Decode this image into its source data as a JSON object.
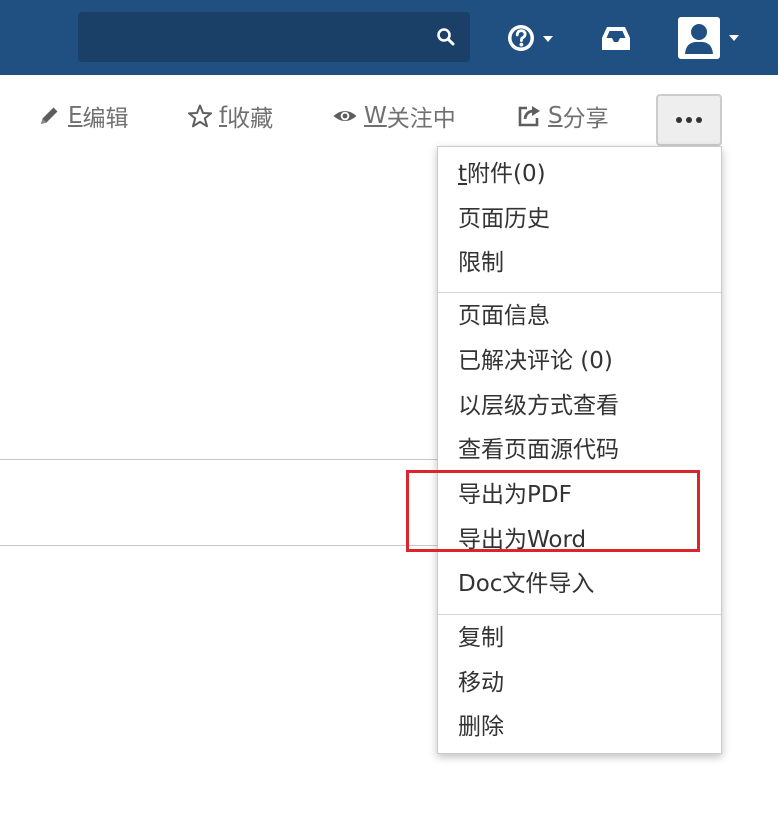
{
  "header": {
    "search": {
      "placeholder": "",
      "icon": "search-icon"
    },
    "help": {
      "icon": "help-icon"
    },
    "notifications": {
      "icon": "inbox-icon"
    },
    "user": {
      "icon": "user-avatar-icon"
    },
    "colors": {
      "bar": "#205081",
      "search_bg": "#1a4068"
    }
  },
  "toolbar": {
    "edit": {
      "key": "E",
      "label": "编辑",
      "icon": "pencil-icon"
    },
    "favorite": {
      "key": "f",
      "label": "收藏",
      "icon": "star-icon"
    },
    "watch": {
      "key": "W",
      "label": "关注中",
      "icon": "eye-icon"
    },
    "share": {
      "key": "S",
      "label": "分享",
      "icon": "share-icon"
    },
    "more": {
      "icon": "more-icon"
    }
  },
  "menu": {
    "attachments": {
      "key": "t",
      "label": "附件(0)"
    },
    "page_history": "页面历史",
    "restrictions": "限制",
    "page_info": "页面信息",
    "resolved_comments": "已解决评论 (0)",
    "hierarchy_view": "以层级方式查看",
    "view_source": "查看页面源代码",
    "export_pdf": "导出为PDF",
    "export_word": "导出为Word",
    "doc_import": "Doc文件导入",
    "copy": "复制",
    "move": "移动",
    "delete": "删除"
  },
  "highlight_color": "#d9252b"
}
